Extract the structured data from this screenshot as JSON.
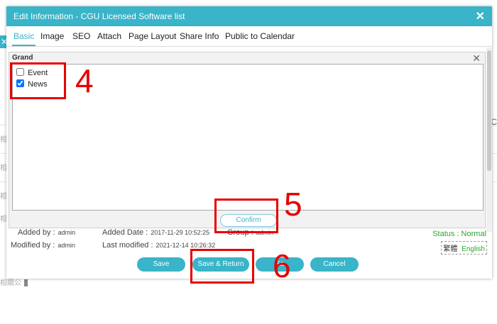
{
  "dialog": {
    "title": "Edit Information - CGU Licensed Software list",
    "close_glyph": "✕"
  },
  "tabs": [
    {
      "label": "Basic",
      "active": true
    },
    {
      "label": "Image"
    },
    {
      "label": "SEO"
    },
    {
      "label": "Attach"
    },
    {
      "label": "Page Layout"
    },
    {
      "label": "Share Info"
    },
    {
      "label": "Public to Calendar"
    }
  ],
  "grand": {
    "title": "Grand",
    "close_glyph": "✕",
    "options": [
      {
        "label": "Event",
        "checked": false
      },
      {
        "label": "News",
        "checked": true
      }
    ],
    "confirm_label": "Confirm"
  },
  "meta": {
    "added_by_label": "Added by :",
    "added_by": "admin",
    "added_date_label": "Added Date :",
    "added_date": "2017-11-29 10:52:25",
    "group_label": "Group :",
    "group": "admin",
    "modified_by_label": "Modified by :",
    "modified_by": "admin",
    "last_modified_label": "Last modified :",
    "last_modified": "2021-12-14 10:26:32",
    "status": "Status : Normal",
    "lang_tc": "繁體",
    "lang_en": "English"
  },
  "buttons": {
    "save": "Save",
    "save_return": "Save & Return",
    "save_hidden": "Sa",
    "cancel": "Cancel"
  },
  "annotations": [
    "4",
    "5",
    "6"
  ],
  "background": {
    "row_label": "相",
    "bottom_text": "相關公",
    "right_fragment": "C"
  },
  "colors": {
    "accent": "#39b4c8",
    "highlight": "#e60000",
    "status": "#2fa52f"
  }
}
